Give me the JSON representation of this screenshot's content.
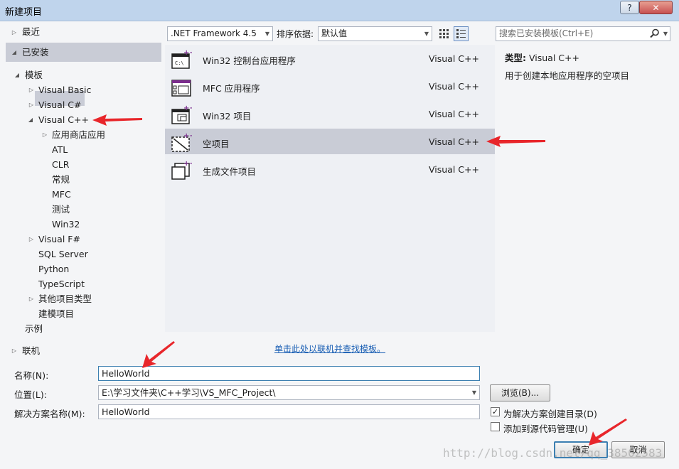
{
  "window": {
    "title": "新建项目",
    "help": "?",
    "close": "✕"
  },
  "tree": {
    "recent": "最近",
    "installed": "已安装",
    "templates": "模板",
    "items": {
      "vb": "Visual Basic",
      "cs": "Visual C#",
      "vcpp": "Visual C++",
      "store": "应用商店应用",
      "atl": "ATL",
      "clr": "CLR",
      "general": "常规",
      "mfc": "MFC",
      "test": "测试",
      "win32": "Win32",
      "fs": "Visual F#",
      "sql": "SQL Server",
      "python": "Python",
      "ts": "TypeScript",
      "other": "其他项目类型",
      "modeling": "建模项目"
    },
    "samples": "示例",
    "online": "联机"
  },
  "toolbar": {
    "framework": ".NET Framework 4.5",
    "sort_label": "排序依据:",
    "sort_value": "默认值"
  },
  "templates": [
    {
      "name": "Win32 控制台应用程序",
      "lang": "Visual C++"
    },
    {
      "name": "MFC 应用程序",
      "lang": "Visual C++"
    },
    {
      "name": "Win32 项目",
      "lang": "Visual C++"
    },
    {
      "name": "空项目",
      "lang": "Visual C++"
    },
    {
      "name": "生成文件项目",
      "lang": "Visual C++"
    }
  ],
  "search": {
    "placeholder": "搜索已安装模板(Ctrl+E)"
  },
  "detail": {
    "type_label": "类型:",
    "type_value": "Visual C++",
    "description": "用于创建本地应用程序的空项目"
  },
  "online_link": "单击此处以联机并查找模板。",
  "form": {
    "name_label": "名称(N):",
    "name_value": "HelloWorld",
    "location_label": "位置(L):",
    "location_value": "E:\\学习文件夹\\C++学习\\VS_MFC_Project\\",
    "solution_label": "解决方案名称(M):",
    "solution_value": "HelloWorld",
    "browse": "浏览(B)...",
    "create_dir": "为解决方案创建目录(D)",
    "add_source_control": "添加到源代码管理(U)",
    "create_dir_checked": true,
    "add_source_control_checked": false,
    "ok": "确定",
    "cancel": "取消"
  },
  "watermark": "http://blog.csdn.net/qq_38502583",
  "colors": {
    "selection": "#c9ccd6",
    "arrow": "#e8262b",
    "link": "#1a5fb4",
    "accent_purple": "#7c2d8e"
  }
}
